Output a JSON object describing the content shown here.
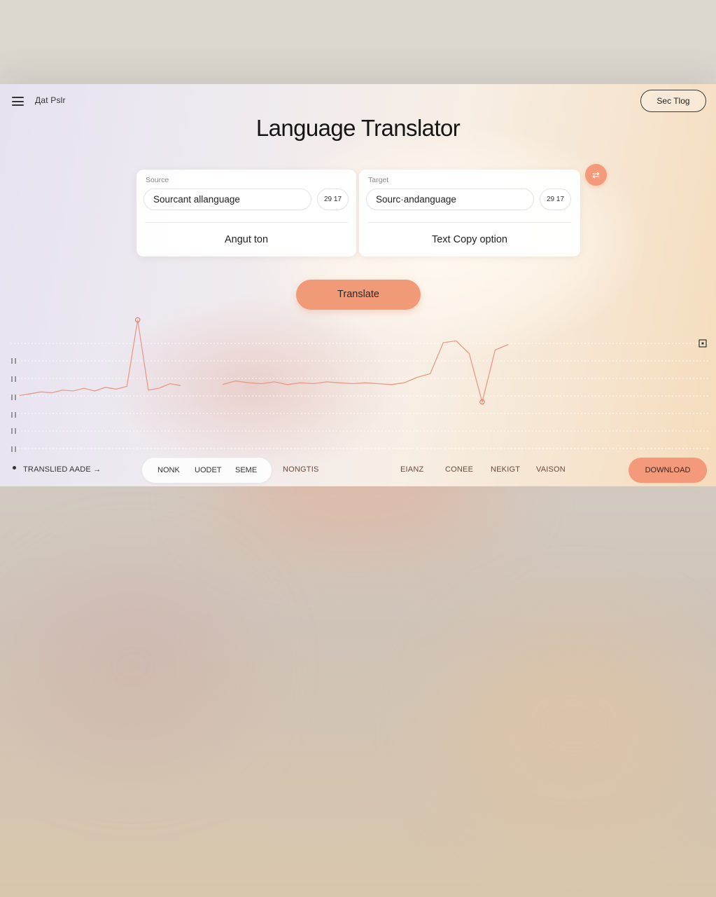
{
  "header": {
    "brand": "Дat Pslr",
    "top_button": "Sec Tlog"
  },
  "title": "Language Translator",
  "source_panel": {
    "label": "Source",
    "language_value": "Sourcant allanguage",
    "count": "29 17",
    "action": "Angut ton"
  },
  "target_panel": {
    "label": "Target",
    "language_value": "Sourc·andanguage",
    "count": "29 17",
    "action": "Text Copy option"
  },
  "swap_icon": "swap-icon",
  "translate_button": "Translate",
  "chart_data": {
    "type": "line",
    "series": [
      {
        "values": [
          0.12,
          0.14,
          0.16,
          0.15,
          0.18,
          0.17,
          0.2,
          0.17,
          0.21,
          0.19,
          0.22,
          0.95,
          0.18,
          0.2,
          0.25,
          0.23,
          0.24,
          0.28,
          0.26,
          0.25,
          0.27,
          0.24,
          0.26,
          0.25,
          0.27,
          0.26,
          0.25,
          0.26,
          0.25,
          0.24,
          0.26,
          0.32,
          0.36,
          0.7,
          0.72,
          0.58,
          0.05,
          0.62,
          0.68
        ]
      }
    ],
    "grid": true,
    "markers": [
      "peak",
      "trough"
    ]
  },
  "chart_icon": "expand-square-icon",
  "bottom_bar": {
    "status": "TRANSLIED AADE →",
    "segments": [
      "NONK",
      "UODET",
      "SEME"
    ],
    "nav": [
      "NONGTIS",
      "EIANZ",
      "CONEE",
      "NEKIGT",
      "VAISON"
    ],
    "download": "DOWNLOAD"
  },
  "colors": {
    "accent": "#f19a77",
    "chart_line": "#e89a86"
  }
}
